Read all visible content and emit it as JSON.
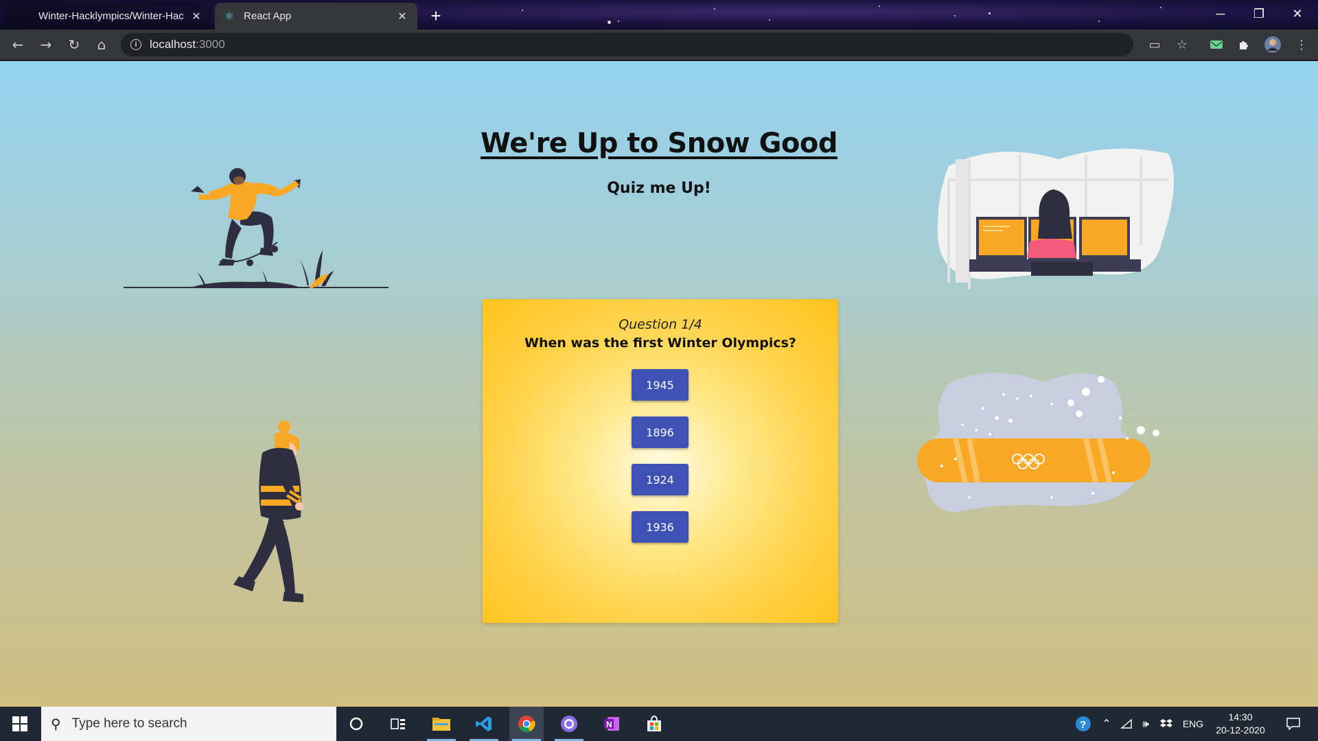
{
  "browser": {
    "tabs": [
      {
        "label": "Winter-Hacklympics/Winter-Hac",
        "favicon": "github-icon"
      },
      {
        "label": "React App",
        "favicon": "react-icon"
      }
    ],
    "new_tab_label": "+",
    "address": {
      "host": "localhost",
      "port": ":3000"
    }
  },
  "page": {
    "title": "We're Up to Snow Good",
    "subtitle": "Quiz me Up!"
  },
  "quiz": {
    "counter": "Question 1/4",
    "question": "When was the first Winter Olympics?",
    "answers": [
      "1945",
      "1896",
      "1924",
      "1936"
    ]
  },
  "taskbar": {
    "search_placeholder": "Type here to search",
    "language": "ENG",
    "time": "14:30",
    "date": "20-12-2020"
  },
  "colors": {
    "accent_orange": "#f9a826",
    "dark_figure": "#2f2e41",
    "button_blue": "#3f51b5",
    "card_yellow": "#ffc21a"
  }
}
